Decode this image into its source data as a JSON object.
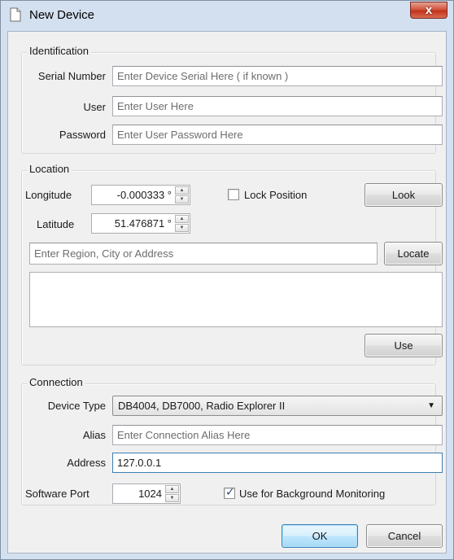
{
  "window": {
    "title": "New Device",
    "close_label": "x"
  },
  "identification": {
    "group_title": "Identification",
    "serial_label": "Serial Number",
    "serial_placeholder": "Enter Device Serial Here ( if known )",
    "user_label": "User",
    "user_placeholder": "Enter User Here",
    "password_label": "Password",
    "password_placeholder": "Enter User Password Here"
  },
  "location": {
    "group_title": "Location",
    "longitude_label": "Longitude",
    "longitude_value": "-0.000333 °",
    "latitude_label": "Latitude",
    "latitude_value": "51.476871 °",
    "lock_position_label": "Lock Position",
    "lock_position_checked": false,
    "look_button": "Look",
    "search_placeholder": "Enter Region, City or Address",
    "locate_button": "Locate",
    "use_button": "Use"
  },
  "connection": {
    "group_title": "Connection",
    "device_type_label": "Device Type",
    "device_type_value": "DB4004, DB7000, Radio Explorer II",
    "alias_label": "Alias",
    "alias_placeholder": "Enter Connection Alias Here",
    "address_label": "Address",
    "address_value": "127.0.0.1",
    "software_port_label": "Software Port",
    "software_port_value": "1024",
    "background_monitoring_label": "Use for Background Monitoring",
    "background_monitoring_checked": true
  },
  "footer": {
    "ok_button": "OK",
    "cancel_button": "Cancel"
  },
  "icons": {
    "spin_up": "▲",
    "spin_down": "▼",
    "dropdown": "▼",
    "check": "✓"
  }
}
